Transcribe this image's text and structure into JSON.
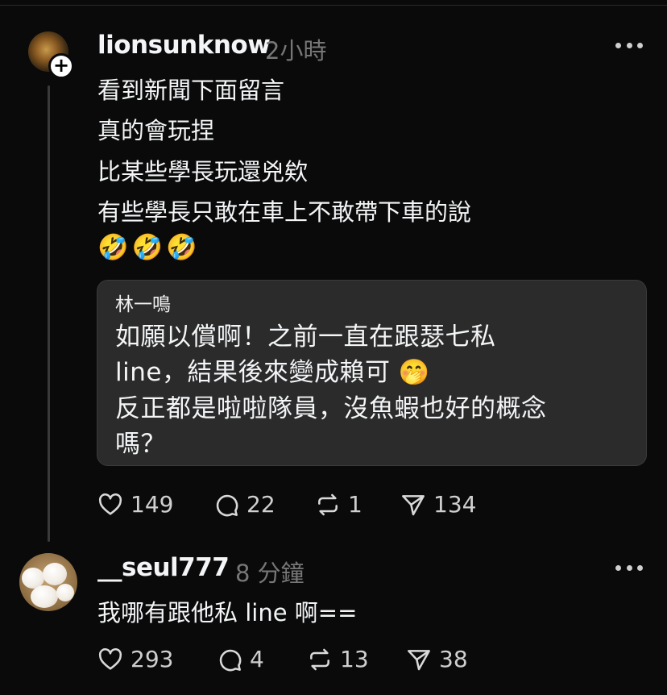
{
  "post": {
    "username": "lionsunknow",
    "time": "2小時",
    "lines": [
      "看到新聞下面留言",
      "真的會玩捏",
      "比某些學長玩還兇欸",
      "有些學長只敢在車上不敢帶下車的說"
    ],
    "emoji_line": "🤣🤣🤣",
    "quote": {
      "author": "林一鳴",
      "lines": [
        "如願以償啊！之前一直在跟瑟七私",
        "line，結果後來變成賴可 🤭",
        "反正都是啦啦隊員，沒魚蝦也好的概念",
        "嗎？"
      ]
    },
    "actions": {
      "likes": "149",
      "comments": "22",
      "reposts": "1",
      "shares": "134"
    }
  },
  "reply": {
    "username": "__seul777",
    "time": "8 分鐘",
    "text": "我哪有跟他私 line 啊==",
    "actions": {
      "likes": "293",
      "comments": "4",
      "reposts": "13",
      "shares": "38"
    }
  },
  "icons": {
    "like": "heart-icon",
    "comment": "comment-bubble-icon",
    "repost": "repost-icon",
    "share": "send-icon",
    "more": "more-horizontal-icon",
    "follow": "plus-icon"
  },
  "colors": {
    "background": "#0a0a0a",
    "text": "#f3f5f7",
    "muted": "#777777",
    "quote_bg": "#2b2b2b"
  }
}
